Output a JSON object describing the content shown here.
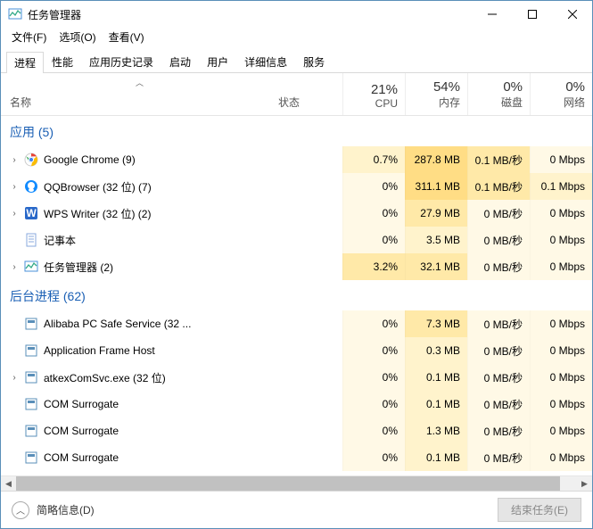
{
  "window": {
    "title": "任务管理器",
    "menu": {
      "file": "文件(F)",
      "options": "选项(O)",
      "view": "查看(V)"
    },
    "tabs": [
      "进程",
      "性能",
      "应用历史记录",
      "启动",
      "用户",
      "详细信息",
      "服务"
    ]
  },
  "columns": {
    "name": "名称",
    "status": "状态",
    "metrics": [
      {
        "pct": "21%",
        "label": "CPU"
      },
      {
        "pct": "54%",
        "label": "内存"
      },
      {
        "pct": "0%",
        "label": "磁盘"
      },
      {
        "pct": "0%",
        "label": "网络"
      }
    ]
  },
  "groups": [
    {
      "title": "应用 (5)",
      "rows": [
        {
          "name": "Google Chrome (9)",
          "icon": "chrome",
          "exp": true,
          "m": [
            "0.7%",
            "287.8 MB",
            "0.1 MB/秒",
            "0 Mbps"
          ],
          "heat": [
            1,
            3,
            2,
            0
          ]
        },
        {
          "name": "QQBrowser (32 位) (7)",
          "icon": "qq",
          "exp": true,
          "m": [
            "0%",
            "311.1 MB",
            "0.1 MB/秒",
            "0.1 Mbps"
          ],
          "heat": [
            0,
            3,
            2,
            1
          ]
        },
        {
          "name": "WPS Writer (32 位) (2)",
          "icon": "wps",
          "exp": true,
          "m": [
            "0%",
            "27.9 MB",
            "0 MB/秒",
            "0 Mbps"
          ],
          "heat": [
            0,
            2,
            0,
            0
          ]
        },
        {
          "name": "记事本",
          "icon": "notepad",
          "exp": false,
          "m": [
            "0%",
            "3.5 MB",
            "0 MB/秒",
            "0 Mbps"
          ],
          "heat": [
            0,
            1,
            0,
            0
          ]
        },
        {
          "name": "任务管理器 (2)",
          "icon": "taskmgr",
          "exp": true,
          "m": [
            "3.2%",
            "32.1 MB",
            "0 MB/秒",
            "0 Mbps"
          ],
          "heat": [
            2,
            2,
            0,
            0
          ]
        }
      ]
    },
    {
      "title": "后台进程 (62)",
      "rows": [
        {
          "name": "Alibaba PC Safe Service (32 ...",
          "icon": "generic",
          "exp": false,
          "m": [
            "0%",
            "7.3 MB",
            "0 MB/秒",
            "0 Mbps"
          ],
          "heat": [
            0,
            2,
            0,
            0
          ]
        },
        {
          "name": "Application Frame Host",
          "icon": "generic",
          "exp": false,
          "m": [
            "0%",
            "0.3 MB",
            "0 MB/秒",
            "0 Mbps"
          ],
          "heat": [
            0,
            1,
            0,
            0
          ]
        },
        {
          "name": "atkexComSvc.exe (32 位)",
          "icon": "generic",
          "exp": true,
          "m": [
            "0%",
            "0.1 MB",
            "0 MB/秒",
            "0 Mbps"
          ],
          "heat": [
            0,
            1,
            0,
            0
          ]
        },
        {
          "name": "COM Surrogate",
          "icon": "generic",
          "exp": false,
          "m": [
            "0%",
            "0.1 MB",
            "0 MB/秒",
            "0 Mbps"
          ],
          "heat": [
            0,
            1,
            0,
            0
          ]
        },
        {
          "name": "COM Surrogate",
          "icon": "generic",
          "exp": false,
          "m": [
            "0%",
            "1.3 MB",
            "0 MB/秒",
            "0 Mbps"
          ],
          "heat": [
            0,
            1,
            0,
            0
          ]
        },
        {
          "name": "COM Surrogate",
          "icon": "generic",
          "exp": false,
          "m": [
            "0%",
            "0.1 MB",
            "0 MB/秒",
            "0 Mbps"
          ],
          "heat": [
            0,
            1,
            0,
            0
          ]
        }
      ]
    }
  ],
  "footer": {
    "less": "简略信息(D)",
    "end": "结束任务(E)"
  },
  "icons": {
    "chrome": "<svg viewBox='0 0 16 16'><circle cx='8' cy='8' r='7' fill='#fff' stroke='#ccc'/><circle cx='8' cy='8' r='3.2' fill='#4285f4'/><path d='M8 1a7 7 0 016 3.4H8' fill='#ea4335'/><path d='M2.2 4.2L6 10.5 8 8' fill='#34a853'/><path d='M8 15a7 7 0 006-10.6L10 8' fill='#fbbc05'/><circle cx='8' cy='8' r='2.6' fill='#4285f4' stroke='#fff'/></svg>",
    "qq": "<svg viewBox='0 0 16 16'><circle cx='8' cy='8' r='7' fill='#118bff'/><circle cx='8' cy='7' r='4' fill='#fff'/><ellipse cx='8' cy='12' rx='3' ry='2' fill='#fff'/></svg>",
    "wps": "<svg viewBox='0 0 16 16'><rect x='1' y='1' width='14' height='14' rx='2' fill='#2968c9'/><text x='8' y='12' font-size='9' fill='#fff' text-anchor='middle' font-weight='bold'>W</text></svg>",
    "notepad": "<svg viewBox='0 0 16 16'><rect x='3' y='1' width='10' height='14' fill='#fff' stroke='#88aadd'/><line x1='5' y1='4' x2='11' y2='4' stroke='#88aadd'/><line x1='5' y1='7' x2='11' y2='7' stroke='#88aadd'/><line x1='5' y1='10' x2='11' y2='10' stroke='#88aadd'/></svg>",
    "taskmgr": "<svg viewBox='0 0 16 16'><rect x='1' y='2' width='14' height='11' fill='#fff' stroke='#4a90d9'/><polyline points='2,10 5,6 8,9 11,4 14,7' fill='none' stroke='#3a8' stroke-width='1.3'/></svg>",
    "generic": "<svg viewBox='0 0 16 16'><rect x='2' y='2' width='12' height='12' fill='#fff' stroke='#5a8fb9'/><rect x='4' y='4' width='8' height='3' fill='#5a8fb9'/></svg>",
    "app": "<svg viewBox='0 0 16 16'><rect x='1' y='2' width='14' height='11' fill='#fff' stroke='#4a90d9'/><polyline points='2,10 5,6 8,9 11,4 14,7' fill='none' stroke='#3a8' stroke-width='1.3'/></svg>"
  }
}
